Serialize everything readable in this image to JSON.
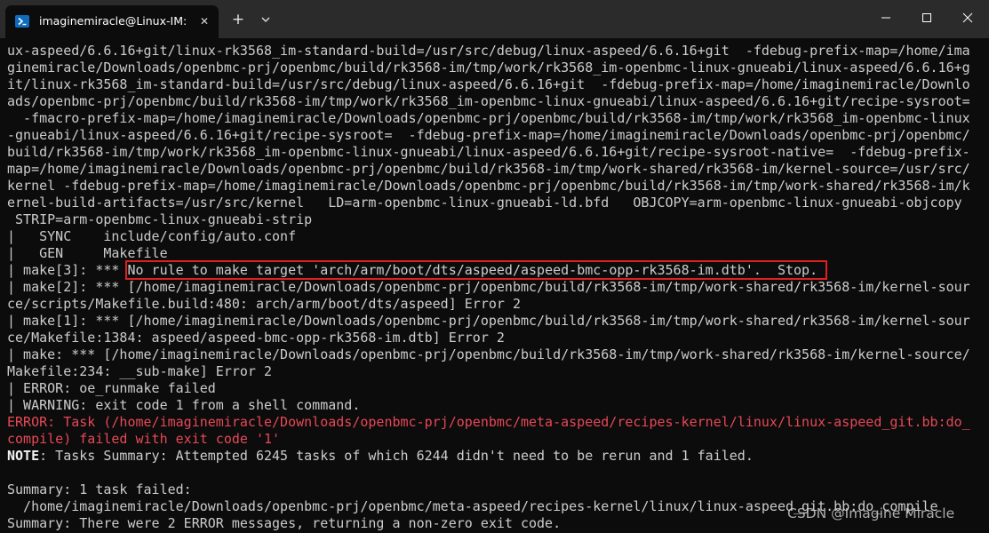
{
  "window": {
    "tab_title": "imaginemiracle@Linux-IM: ~/",
    "tab_close": "✕",
    "new_tab": "+",
    "colors": {
      "titlebar_bg": "#2b2b2b",
      "terminal_bg": "#0c0c0c",
      "text": "#cccccc",
      "error": "#e74856",
      "highlight_box": "#e02020"
    }
  },
  "terminal": {
    "lines": [
      {
        "segments": [
          {
            "text": "ux-aspeed/6.6.16+git/linux-rk3568_im-standard-build=/usr/src/debug/linux-aspeed/6.6.16+git  -fdebug-prefix-map=/home/ima"
          }
        ]
      },
      {
        "segments": [
          {
            "text": "ginemiracle/Downloads/openbmc-prj/openbmc/build/rk3568-im/tmp/work/rk3568_im-openbmc-linux-gnueabi/linux-aspeed/6.6.16+g"
          }
        ]
      },
      {
        "segments": [
          {
            "text": "it/linux-rk3568_im-standard-build=/usr/src/debug/linux-aspeed/6.6.16+git  -fdebug-prefix-map=/home/imaginemiracle/Downlo"
          }
        ]
      },
      {
        "segments": [
          {
            "text": "ads/openbmc-prj/openbmc/build/rk3568-im/tmp/work/rk3568_im-openbmc-linux-gnueabi/linux-aspeed/6.6.16+git/recipe-sysroot="
          }
        ]
      },
      {
        "segments": [
          {
            "text": "  -fmacro-prefix-map=/home/imaginemiracle/Downloads/openbmc-prj/openbmc/build/rk3568-im/tmp/work/rk3568_im-openbmc-linux"
          }
        ]
      },
      {
        "segments": [
          {
            "text": "-gnueabi/linux-aspeed/6.6.16+git/recipe-sysroot=  -fdebug-prefix-map=/home/imaginemiracle/Downloads/openbmc-prj/openbmc/"
          }
        ]
      },
      {
        "segments": [
          {
            "text": "build/rk3568-im/tmp/work/rk3568_im-openbmc-linux-gnueabi/linux-aspeed/6.6.16+git/recipe-sysroot-native=  -fdebug-prefix-"
          }
        ]
      },
      {
        "segments": [
          {
            "text": "map=/home/imaginemiracle/Downloads/openbmc-prj/openbmc/build/rk3568-im/tmp/work-shared/rk3568-im/kernel-source=/usr/src/"
          }
        ]
      },
      {
        "segments": [
          {
            "text": "kernel -fdebug-prefix-map=/home/imaginemiracle/Downloads/openbmc-prj/openbmc/build/rk3568-im/tmp/work-shared/rk3568-im/k"
          }
        ]
      },
      {
        "segments": [
          {
            "text": "ernel-build-artifacts=/usr/src/kernel   LD=arm-openbmc-linux-gnueabi-ld.bfd   OBJCOPY=arm-openbmc-linux-gnueabi-objcopy"
          }
        ]
      },
      {
        "segments": [
          {
            "text": " STRIP=arm-openbmc-linux-gnueabi-strip"
          }
        ]
      },
      {
        "segments": [
          {
            "text": "|   SYNC    include/config/auto.conf"
          }
        ]
      },
      {
        "segments": [
          {
            "text": "|   GEN     Makefile"
          }
        ]
      },
      {
        "segments": [
          {
            "text": "| make[3]: *** "
          },
          {
            "text": "No rule to make target 'arch/arm/boot/dts/aspeed/aspeed-bmc-opp-rk3568-im.dtb'.  Stop. ",
            "style": "highlight"
          }
        ]
      },
      {
        "segments": [
          {
            "text": "| make[2]: *** [/home/imaginemiracle/Downloads/openbmc-prj/openbmc/build/rk3568-im/tmp/work-shared/rk3568-im/kernel-sour"
          }
        ]
      },
      {
        "segments": [
          {
            "text": "ce/scripts/Makefile.build:480: arch/arm/boot/dts/aspeed] Error 2"
          }
        ]
      },
      {
        "segments": [
          {
            "text": "| make[1]: *** [/home/imaginemiracle/Downloads/openbmc-prj/openbmc/build/rk3568-im/tmp/work-shared/rk3568-im/kernel-sour"
          }
        ]
      },
      {
        "segments": [
          {
            "text": "ce/Makefile:1384: aspeed/aspeed-bmc-opp-rk3568-im.dtb] Error 2"
          }
        ]
      },
      {
        "segments": [
          {
            "text": "| make: *** [/home/imaginemiracle/Downloads/openbmc-prj/openbmc/build/rk3568-im/tmp/work-shared/rk3568-im/kernel-source/"
          }
        ]
      },
      {
        "segments": [
          {
            "text": "Makefile:234: __sub-make] Error 2"
          }
        ]
      },
      {
        "segments": [
          {
            "text": "| ERROR: oe_runmake failed"
          }
        ]
      },
      {
        "segments": [
          {
            "text": "| WARNING: exit code 1 from a shell command."
          }
        ]
      },
      {
        "segments": [
          {
            "text": "ERROR: Task (/home/imaginemiracle/Downloads/openbmc-prj/openbmc/meta-aspeed/recipes-kernel/linux/linux-aspeed_git.bb:do_",
            "style": "error"
          }
        ]
      },
      {
        "segments": [
          {
            "text": "compile) failed with exit code '1'",
            "style": "error"
          }
        ]
      },
      {
        "segments": [
          {
            "text": "NOTE",
            "style": "bold"
          },
          {
            "text": ": Tasks Summary: Attempted 6245 tasks of which 6244 didn't need to be rerun and 1 failed."
          }
        ]
      },
      {
        "segments": [
          {
            "text": ""
          }
        ]
      },
      {
        "segments": [
          {
            "text": "Summary: 1 task failed:"
          }
        ]
      },
      {
        "segments": [
          {
            "text": "  /home/imaginemiracle/Downloads/openbmc-prj/openbmc/meta-aspeed/recipes-kernel/linux/linux-aspeed_git.bb:do_compile"
          }
        ]
      },
      {
        "segments": [
          {
            "text": "Summary: There were 2 ERROR messages, returning a non-zero exit code."
          }
        ]
      }
    ]
  },
  "watermark": "CSDN @Imagine Miracle"
}
